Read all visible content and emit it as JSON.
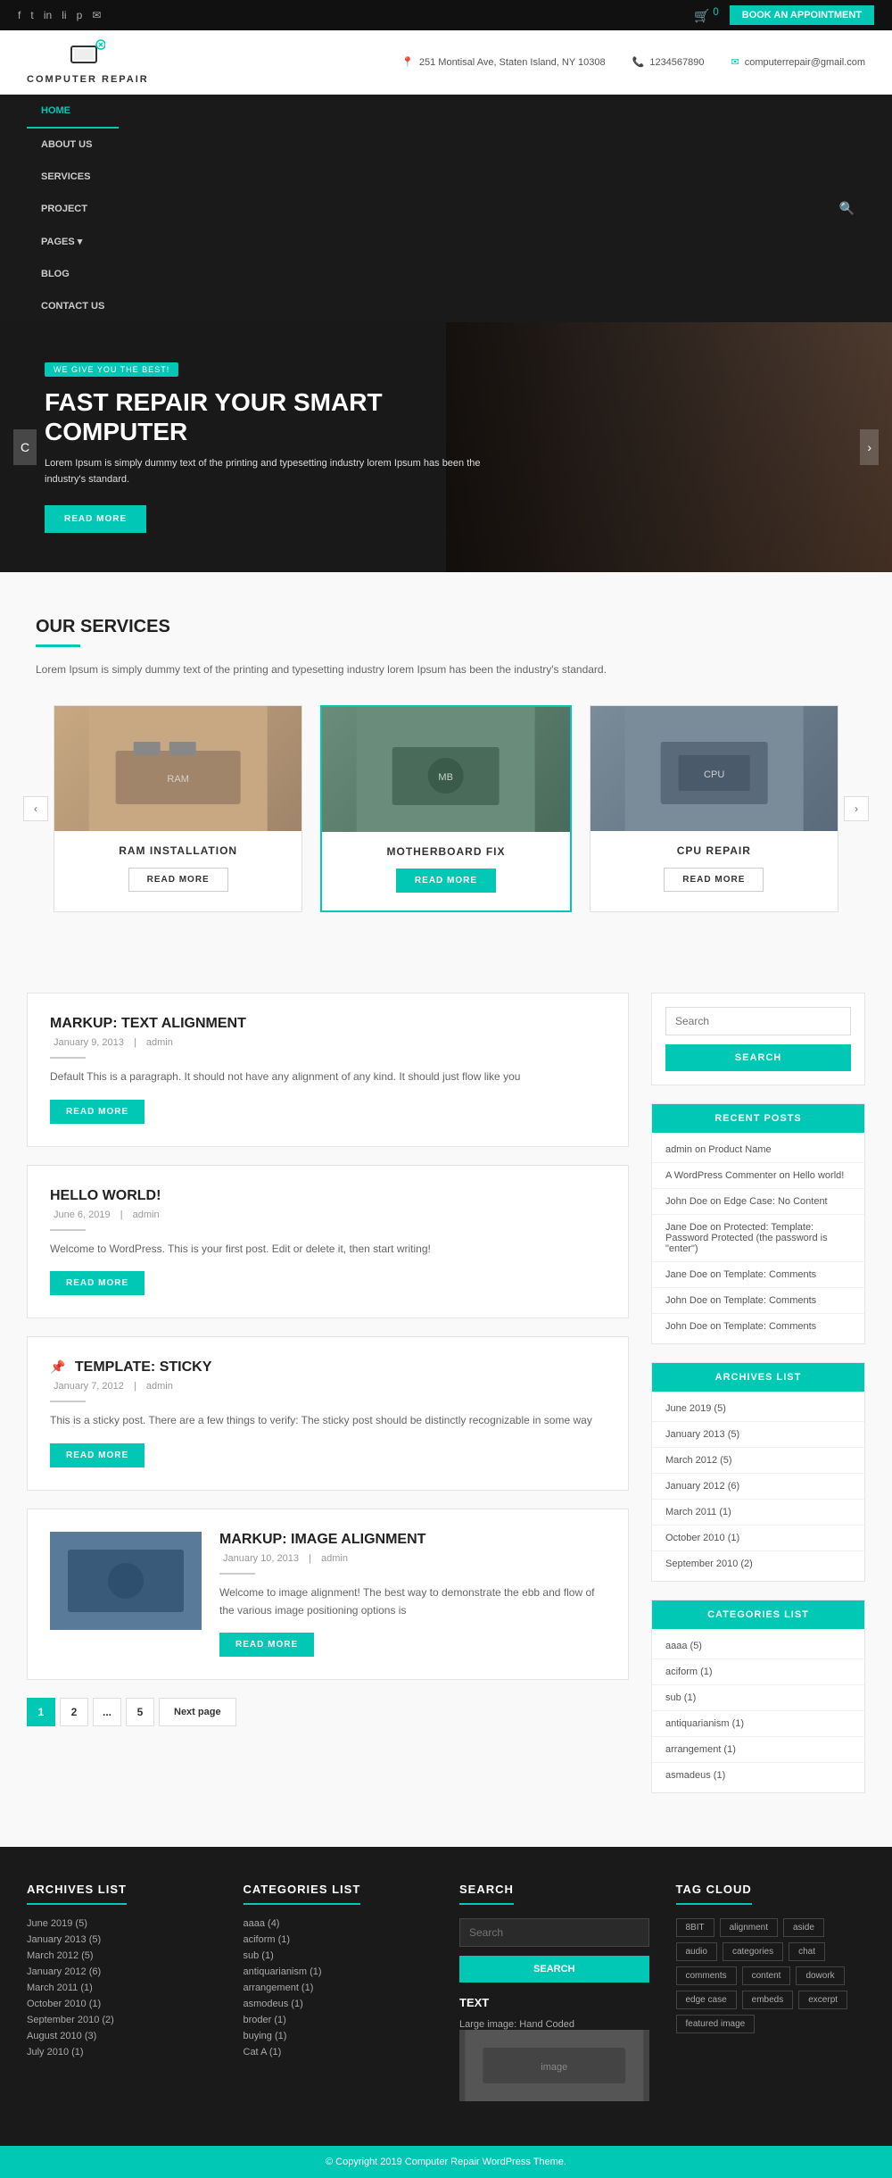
{
  "topbar": {
    "social": [
      "facebook",
      "twitter",
      "instagram",
      "linkedin",
      "pinterest",
      "email"
    ],
    "cart_label": "🛒",
    "cart_count": "0",
    "book_btn": "Book An Appointment"
  },
  "logo": {
    "text": "COMPUTER REPAIR",
    "icon": "🖥️"
  },
  "contact": {
    "address": "251 Montisal Ave, Staten Island, NY 10308",
    "phone": "1234567890",
    "email": "computerrepair@gmail.com"
  },
  "nav": {
    "items": [
      "Home",
      "About Us",
      "Services",
      "Project",
      "Pages",
      "Blog",
      "Contact Us"
    ],
    "active": "Home"
  },
  "hero": {
    "badge": "WE GIVE YOU THE BEST!",
    "title": "FAST REPAIR YOUR SMART COMPUTER",
    "desc": "Lorem Ipsum is simply dummy text of the printing and typesetting industry lorem Ipsum has been the industry's standard.",
    "btn": "READ MORE"
  },
  "services": {
    "title": "OUR SERVICES",
    "desc": "Lorem Ipsum is simply dummy text of the printing and typesetting industry lorem Ipsum has been the industry's standard.",
    "items": [
      {
        "name": "RAM INSTALLATION",
        "btn": "READ MORE",
        "active": false
      },
      {
        "name": "MOTHERBOARD FIX",
        "btn": "READ MORE",
        "active": true
      },
      {
        "name": "CPU REPAIR",
        "btn": "READ MORE",
        "active": false
      }
    ]
  },
  "posts": [
    {
      "title": "MARKUP: TEXT ALIGNMENT",
      "date": "January 9, 2013",
      "author": "admin",
      "excerpt": "Default This is a paragraph. It should not have any alignment of any kind. It should just flow like you",
      "btn": "READ MORE",
      "type": "text"
    },
    {
      "title": "HELLO WORLD!",
      "date": "June 6, 2019",
      "author": "admin",
      "excerpt": "Welcome to WordPress. This is your first post. Edit or delete it, then start writing!",
      "btn": "READ MORE",
      "type": "text"
    },
    {
      "title": "TEMPLATE: STICKY",
      "date": "January 7, 2012",
      "author": "admin",
      "excerpt": "This is a sticky post. There are a few things to verify: The sticky post should be distinctly recognizable in some way",
      "btn": "READ MORE",
      "type": "sticky"
    },
    {
      "title": "MARKUP: IMAGE ALIGNMENT",
      "date": "January 10, 2013",
      "author": "admin",
      "excerpt": "Welcome to image alignment! The best way to demonstrate the ebb and flow of the various image positioning options is",
      "btn": "READ MORE",
      "type": "image"
    }
  ],
  "pagination": {
    "pages": [
      "1",
      "2",
      "...",
      "5"
    ],
    "next": "Next page"
  },
  "sidebar": {
    "search_placeholder": "Search",
    "search_btn": "SEARCH",
    "recent_posts_title": "RECENT POSTS",
    "recent_posts": [
      "admin on Product Name",
      "A WordPress Commenter on Hello world!",
      "John Doe on Edge Case: No Content",
      "Jane Doe on Protected: Template: Password Protected (the password is \"enter\")",
      "Jane Doe on Template: Comments",
      "John Doe on Template: Comments",
      "John Doe on Template: Comments"
    ],
    "archives_title": "ARCHIVES LIST",
    "archives": [
      "June 2019 (5)",
      "January 2013 (5)",
      "March 2012 (5)",
      "January 2012 (6)",
      "March 2011 (1)",
      "October 2010 (1)",
      "September 2010 (2)"
    ],
    "categories_title": "CATEGORIES LIST",
    "categories": [
      "aaaa (5)",
      "aciform (1)",
      "sub (1)",
      "antiquarianism (1)",
      "arrangement (1)",
      "asmadeus (1)"
    ]
  },
  "footer": {
    "archives_title": "ARCHIVES LIST",
    "archives": [
      "June 2019 (5)",
      "January 2013 (5)",
      "March 2012 (5)",
      "January 2012 (6)",
      "March 2011 (1)",
      "October 2010 (1)",
      "September 2010 (2)",
      "August 2010 (3)",
      "July 2010 (1)"
    ],
    "categories_title": "CATEGORIES LIST",
    "categories": [
      "aaaa (4)",
      "aciform (1)",
      "sub (1)",
      "antiquarianism (1)",
      "arrangement (1)",
      "asmodeus (1)",
      "broder (1)",
      "buying (1)",
      "Cat A (1)"
    ],
    "search_title": "SEARCH",
    "search_placeholder": "Search",
    "search_btn": "SEARCH",
    "text_section_title": "TEXT",
    "text_sublabel": "Large image: Hand Coded",
    "tagcloud_title": "TAG CLOUD",
    "tags": [
      "8BIT",
      "alignment",
      "aside",
      "audio",
      "categories",
      "chat",
      "comments",
      "content",
      "dowork",
      "edge case",
      "embeds",
      "excerpt",
      "featured image"
    ],
    "copyright": "© Copyright 2019 Computer Repair WordPress Theme."
  }
}
